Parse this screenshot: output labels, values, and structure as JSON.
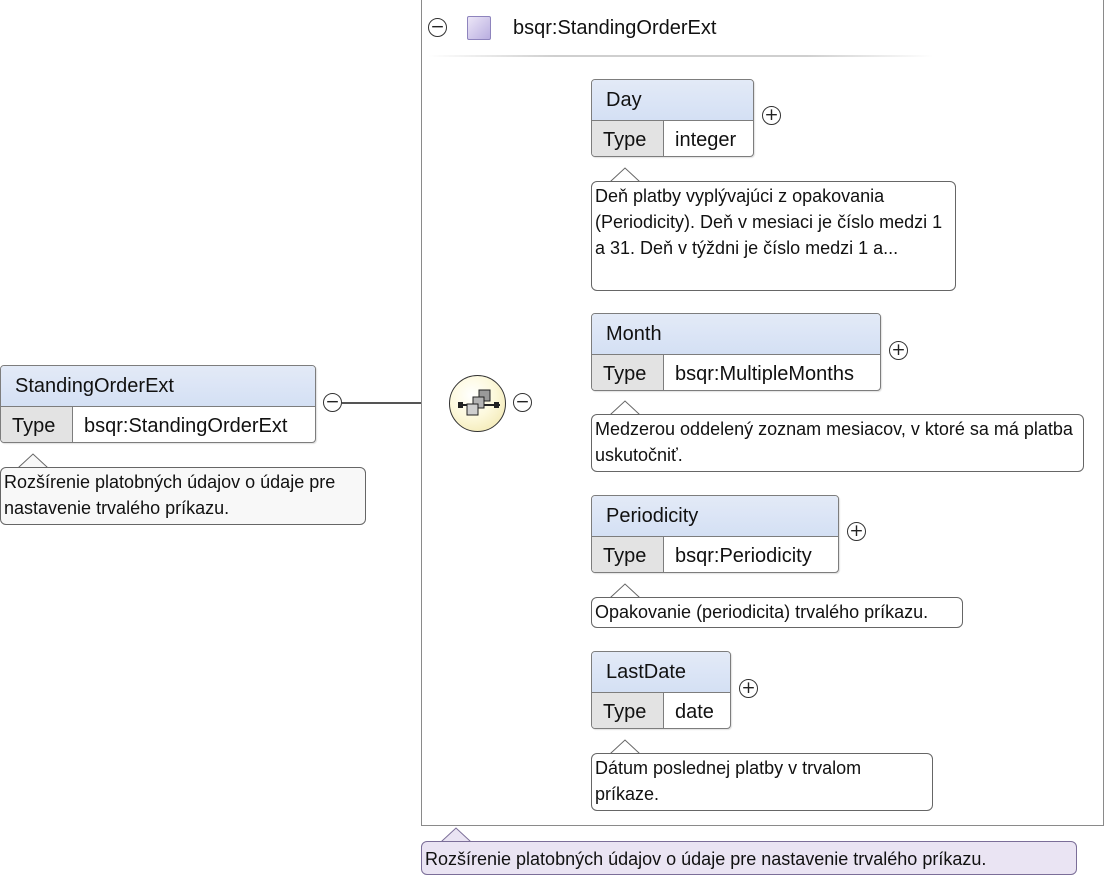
{
  "root": {
    "name": "StandingOrderExt",
    "type_key": "Type",
    "type_value": "bsqr:StandingOrderExt",
    "doc": "Rozšírenie platobných údajov o údaje pre nastavenie trvalého príkazu."
  },
  "container": {
    "title": "bsqr:StandingOrderExt",
    "doc": "Rozšírenie platobných údajov o údaje pre nastavenie trvalého príkazu."
  },
  "children": [
    {
      "name": "Day",
      "type_key": "Type",
      "type_value": "integer",
      "doc": "Deň platby vyplývajúci z opakovania (Periodicity). Deň v mesiaci je číslo medzi 1 a 31. Deň v týždni je číslo medzi 1 a..."
    },
    {
      "name": "Month",
      "type_key": "Type",
      "type_value": "bsqr:MultipleMonths",
      "doc": "Medzerou oddelený zoznam mesiacov, v ktoré sa má platba uskutočniť."
    },
    {
      "name": "Periodicity",
      "type_key": "Type",
      "type_value": "bsqr:Periodicity",
      "doc": "Opakovanie (periodicita) trvalého príkazu."
    },
    {
      "name": "LastDate",
      "type_key": "Type",
      "type_value": "date",
      "doc": "Dátum poslednej platby v trvalom príkaze."
    }
  ],
  "icons": {
    "collapse": "minus-circle-icon",
    "expand": "plus-circle-icon",
    "type": "complex-type-icon",
    "compositor": "sequence-compositor-icon"
  },
  "colors": {
    "element_header": "#dbe5f5",
    "type_cell": "#e3e3e3",
    "compositor_fill": "#f6efc4",
    "type_icon": "#c8bfe7",
    "container_doc_fill": "#eae4f3"
  }
}
